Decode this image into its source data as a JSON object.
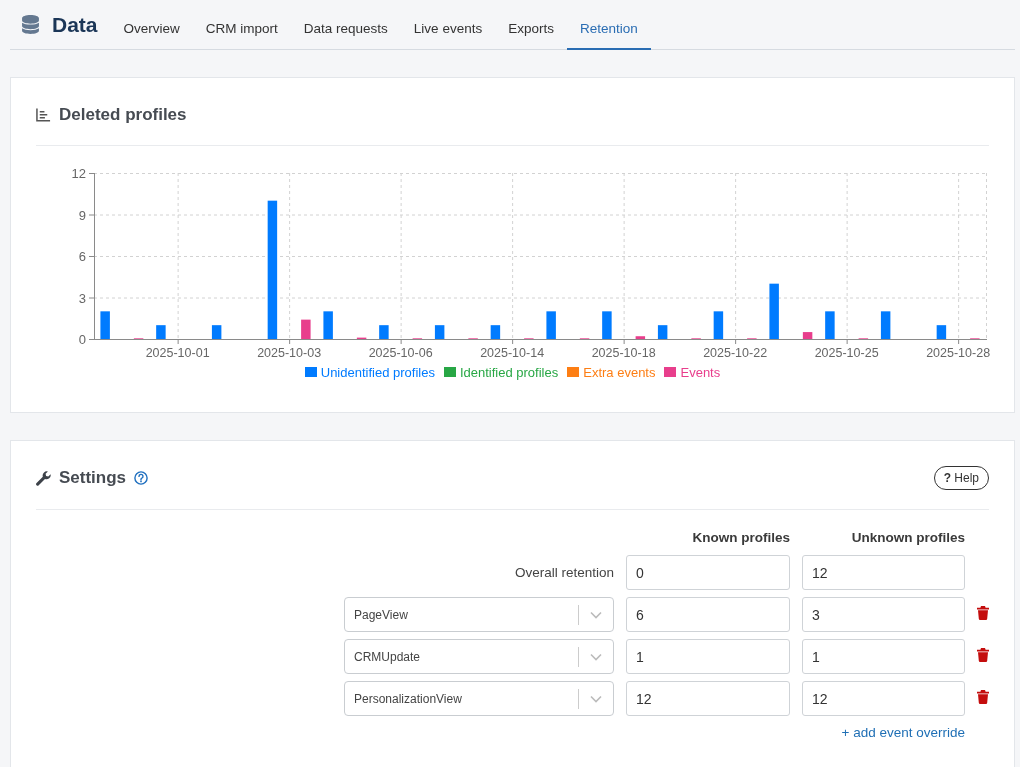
{
  "header": {
    "title": "Data"
  },
  "tabs": [
    {
      "label": "Overview",
      "selected": false
    },
    {
      "label": "CRM import",
      "selected": false
    },
    {
      "label": "Data requests",
      "selected": false
    },
    {
      "label": "Live events",
      "selected": false
    },
    {
      "label": "Exports",
      "selected": false
    },
    {
      "label": "Retention",
      "selected": true
    }
  ],
  "deleted_profiles": {
    "title": "Deleted profiles",
    "chart_data": {
      "type": "bar",
      "categories": [
        null,
        "2025-10-01",
        null,
        "2025-10-03",
        null,
        "2025-10-06",
        null,
        "2025-10-14",
        null,
        "2025-10-18",
        null,
        "2025-10-22",
        null,
        "2025-10-25",
        null,
        "2025-10-28"
      ],
      "ylim": [
        0,
        12
      ],
      "yticks": [
        0,
        3,
        6,
        9,
        12
      ],
      "grid": true,
      "series": [
        {
          "name": "Unidentified profiles",
          "color": "#007bff",
          "values": [
            2,
            1,
            1,
            10,
            2,
            1,
            1,
            1,
            2,
            2,
            1,
            2,
            4,
            2,
            2,
            1
          ]
        },
        {
          "name": "Identified profiles",
          "color": "#28a745",
          "values": [
            0,
            0,
            0,
            0,
            0,
            0,
            0,
            0,
            0,
            0,
            0,
            0,
            0,
            0,
            0,
            0
          ]
        },
        {
          "name": "Extra events",
          "color": "#fd7e14",
          "values": [
            0,
            0,
            0,
            0,
            0,
            0,
            0,
            0,
            0,
            0,
            0,
            0,
            0,
            0,
            0,
            0
          ]
        },
        {
          "name": "Events",
          "color": "#e83e8c",
          "values": [
            0.05,
            0,
            0,
            1.4,
            0.1,
            0.05,
            0.05,
            0.05,
            0.05,
            0.2,
            0.05,
            0.05,
            0.5,
            0.05,
            0,
            0.05
          ]
        }
      ]
    }
  },
  "settings": {
    "title": "Settings",
    "help_button": "**?** Help",
    "columns": [
      "Known profiles",
      "Unknown profiles"
    ],
    "overall_retention": {
      "label": "Overall retention",
      "known": "0",
      "unknown": "12"
    },
    "event_overrides": [
      {
        "event": "PageView",
        "known": "6",
        "unknown": "3"
      },
      {
        "event": "CRMUpdate",
        "known": "1",
        "unknown": "1"
      },
      {
        "event": "PersonalizationView",
        "known": "12",
        "unknown": "12"
      }
    ],
    "add_link": "+ add event override"
  }
}
